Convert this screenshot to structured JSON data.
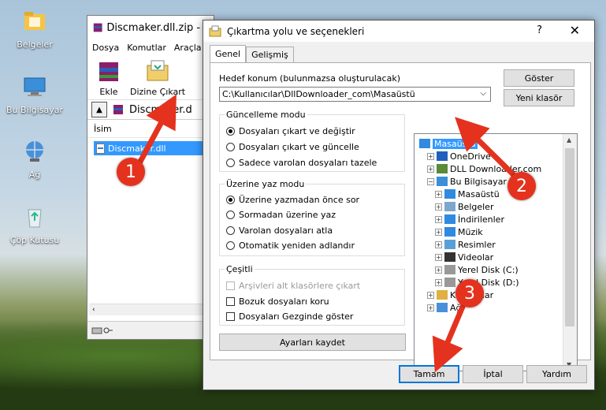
{
  "desktop": {
    "icons": [
      {
        "label": "Belgeler",
        "icon": "folder-documents-icon"
      },
      {
        "label": "Bu Bilgisayar",
        "icon": "computer-icon"
      },
      {
        "label": "Ağ",
        "icon": "network-icon"
      },
      {
        "label": "Çöp Kutusu",
        "icon": "recycle-bin-icon"
      }
    ]
  },
  "winrar": {
    "title": "Discmaker.dll.zip - W",
    "menu": [
      "Dosya",
      "Komutlar",
      "Araçla"
    ],
    "toolbar": {
      "add_label": "Ekle",
      "extract_label": "Dizine Çıkart"
    },
    "address": "Discmaker.d",
    "column_name": "İsim",
    "file": "Discmaker.dll"
  },
  "dialog": {
    "title": "Çıkartma yolu ve seçenekleri",
    "help": "?",
    "close": "✕",
    "tabs": [
      "Genel",
      "Gelişmiş"
    ],
    "dest_label": "Hedef konum (bulunmazsa oluşturulacak)",
    "dest_value": "C:\\Kullanıcılar\\DllDownloader_com\\Masaüstü",
    "show_button": "Göster",
    "new_folder_button": "Yeni klasör",
    "update_mode": {
      "title": "Güncelleme modu",
      "options": [
        "Dosyaları çıkart ve değiştir",
        "Dosyaları çıkart ve güncelle",
        "Sadece varolan dosyaları tazele"
      ],
      "selected": 0
    },
    "overwrite_mode": {
      "title": "Üzerine yaz modu",
      "options": [
        "Üzerine yazmadan önce sor",
        "Sormadan üzerine yaz",
        "Varolan dosyaları atla",
        "Otomatik yeniden adlandır"
      ],
      "selected": 0
    },
    "misc": {
      "title": "Çeşitli",
      "options": [
        "Arşivleri alt klasörlere çıkart",
        "Bozuk dosyaları koru",
        "Dosyaları Gezginde göster"
      ]
    },
    "save_settings_button": "Ayarları kaydet",
    "tree": [
      {
        "label": "Masaüstü",
        "level": 0,
        "expander": "",
        "icon": "desktop-folder-icon",
        "selected": true
      },
      {
        "label": "OneDrive",
        "level": 1,
        "expander": "+",
        "icon": "onedrive-icon"
      },
      {
        "label": "DLL Downloader.com",
        "level": 1,
        "expander": "+",
        "icon": "user-folder-icon"
      },
      {
        "label": "Bu Bilgisayar",
        "level": 1,
        "expander": "−",
        "icon": "computer-icon"
      },
      {
        "label": "Masaüstü",
        "level": 2,
        "expander": "+",
        "icon": "desktop-folder-icon"
      },
      {
        "label": "Belgeler",
        "level": 2,
        "expander": "+",
        "icon": "documents-icon"
      },
      {
        "label": "İndirilenler",
        "level": 2,
        "expander": "+",
        "icon": "downloads-icon"
      },
      {
        "label": "Müzik",
        "level": 2,
        "expander": "+",
        "icon": "music-icon"
      },
      {
        "label": "Resimler",
        "level": 2,
        "expander": "+",
        "icon": "pictures-icon"
      },
      {
        "label": "Videolar",
        "level": 2,
        "expander": "+",
        "icon": "videos-icon"
      },
      {
        "label": "Yerel Disk (C:)",
        "level": 2,
        "expander": "+",
        "icon": "drive-icon"
      },
      {
        "label": "Yerel Disk (D:)",
        "level": 2,
        "expander": "+",
        "icon": "drive-icon"
      },
      {
        "label": "Kitaplıklar",
        "level": 1,
        "expander": "+",
        "icon": "libraries-icon"
      },
      {
        "label": "Ağ",
        "level": 1,
        "expander": "+",
        "icon": "network-icon"
      }
    ],
    "ok_button": "Tamam",
    "cancel_button": "İptal",
    "help_button": "Yardım"
  },
  "markers": [
    "1",
    "2",
    "3"
  ],
  "colors": {
    "selection": "#3399ff",
    "marker": "#e4321e"
  }
}
